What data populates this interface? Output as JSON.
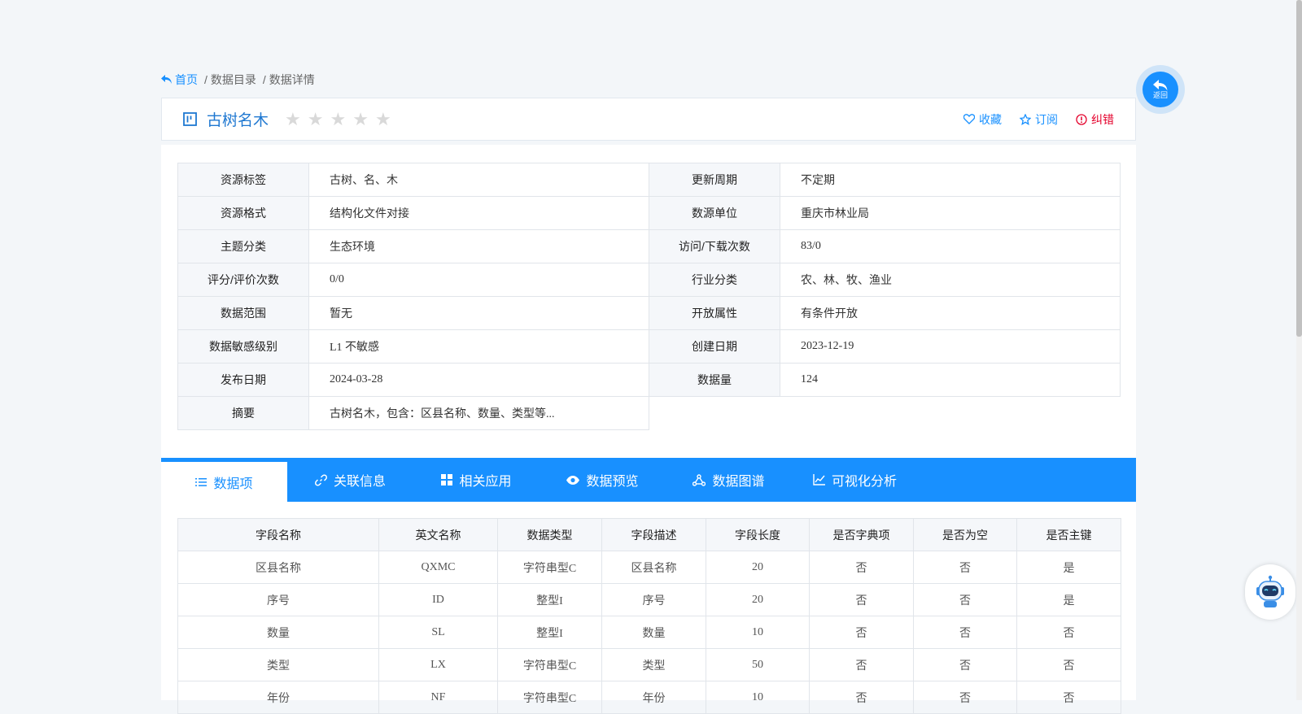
{
  "breadcrumb": {
    "home": "首页",
    "catalog": "数据目录",
    "detail": "数据详情"
  },
  "title": "古树名木",
  "rating": {
    "max": 5,
    "value": 0
  },
  "actions": {
    "favorite": "收藏",
    "subscribe": "订阅",
    "report_error": "纠错"
  },
  "info": {
    "rows": [
      [
        {
          "label": "资源标签",
          "value": "古树、名、木"
        },
        {
          "label": "更新周期",
          "value": "不定期"
        }
      ],
      [
        {
          "label": "资源格式",
          "value": "结构化文件对接"
        },
        {
          "label": "数源单位",
          "value": "重庆市林业局"
        }
      ],
      [
        {
          "label": "主题分类",
          "value": "生态环境"
        },
        {
          "label": "访问/下载次数",
          "value": "83/0"
        }
      ],
      [
        {
          "label": "评分/评价次数",
          "value": "0/0"
        },
        {
          "label": "行业分类",
          "value": "农、林、牧、渔业"
        }
      ],
      [
        {
          "label": "数据范围",
          "value": "暂无"
        },
        {
          "label": "开放属性",
          "value": "有条件开放"
        }
      ],
      [
        {
          "label": "数据敏感级别",
          "value": "L1 不敏感"
        },
        {
          "label": "创建日期",
          "value": "2023-12-19"
        }
      ],
      [
        {
          "label": "发布日期",
          "value": "2024-03-28"
        },
        {
          "label": "数据量",
          "value": "124"
        }
      ],
      [
        {
          "label": "摘要",
          "value": "古树名木，包含：区县名称、数量、类型等..."
        }
      ]
    ]
  },
  "tabs": [
    "数据项",
    "关联信息",
    "相关应用",
    "数据预览",
    "数据图谱",
    "可视化分析"
  ],
  "fields": {
    "headers": [
      "字段名称",
      "英文名称",
      "数据类型",
      "字段描述",
      "字段长度",
      "是否字典项",
      "是否为空",
      "是否主键"
    ],
    "rows": [
      [
        "区县名称",
        "QXMC",
        "字符串型C",
        "区县名称",
        "20",
        "否",
        "否",
        "是"
      ],
      [
        "序号",
        "ID",
        "整型I",
        "序号",
        "20",
        "否",
        "否",
        "是"
      ],
      [
        "数量",
        "SL",
        "整型I",
        "数量",
        "10",
        "否",
        "否",
        "否"
      ],
      [
        "类型",
        "LX",
        "字符串型C",
        "类型",
        "50",
        "否",
        "否",
        "否"
      ],
      [
        "年份",
        "NF",
        "字符串型C",
        "年份",
        "10",
        "否",
        "否",
        "否"
      ]
    ]
  },
  "back_button": "返回",
  "icons": {
    "home": "reply-arrow-icon",
    "title": "board-icon",
    "star": "star-icon",
    "favorite": "heart-icon",
    "subscribe": "star-outline-icon",
    "report_error": "alert-circle-icon",
    "tabs": [
      "list-icon",
      "link-icon",
      "grid-icon",
      "eye-icon",
      "graph-icon",
      "line-chart-icon"
    ],
    "robot": "robot-icon"
  },
  "colors": {
    "accent": "#1890ff",
    "error": "#e4002b",
    "star_empty": "#d9d9d9",
    "background": "#f3f6f9"
  }
}
